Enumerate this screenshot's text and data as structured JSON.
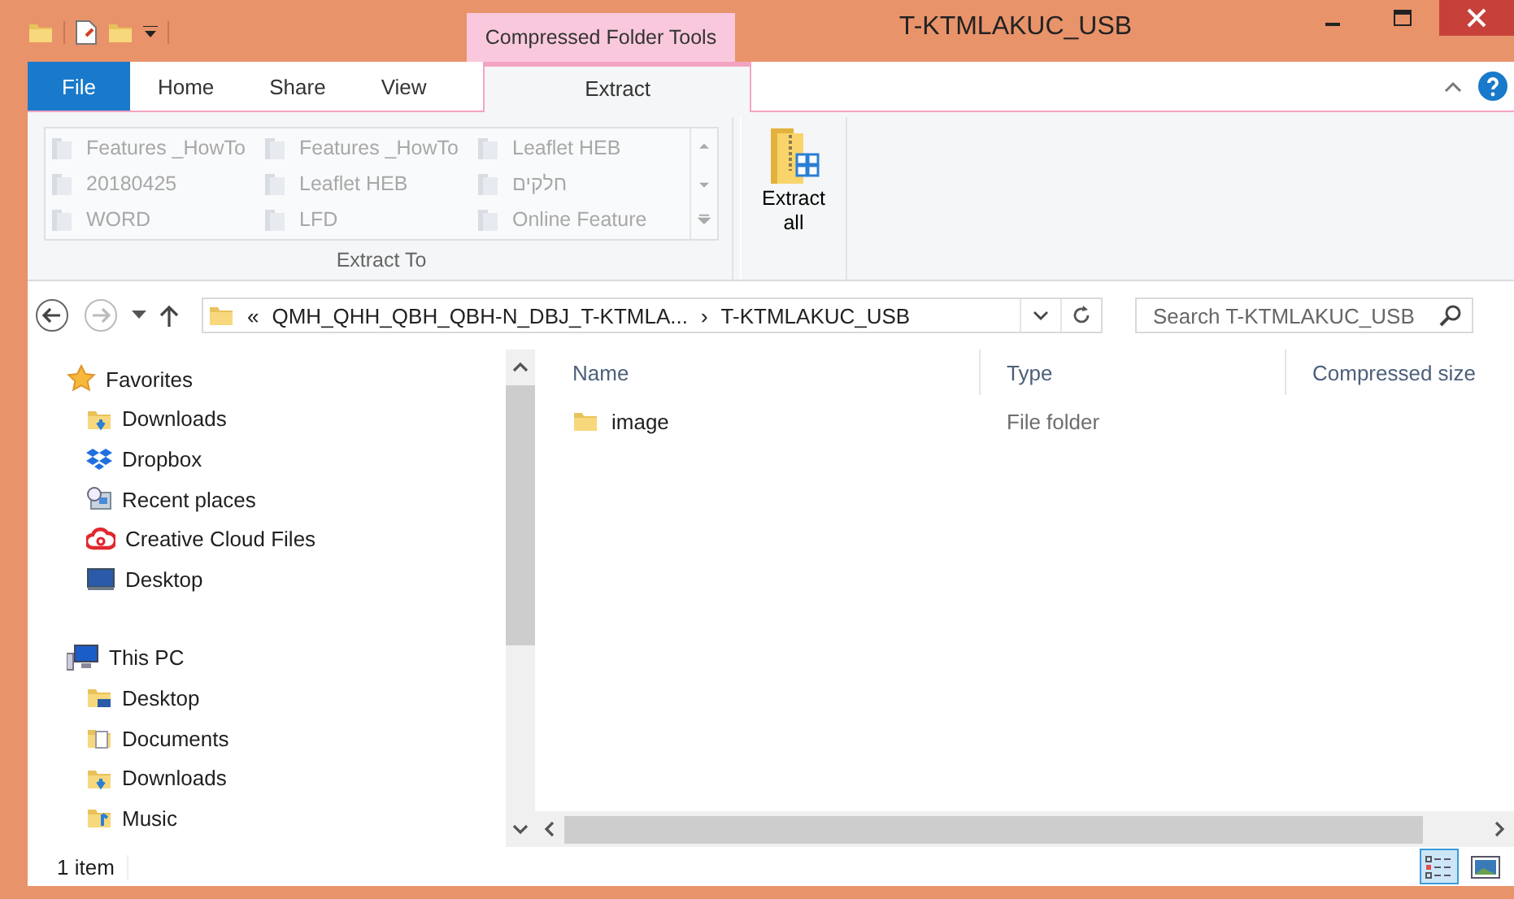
{
  "window": {
    "title": "T-KTMLAKUC_USB",
    "context_tab_group": "Compressed Folder Tools"
  },
  "ribbon_tabs": [
    {
      "label": "File",
      "kind": "file",
      "selected": false
    },
    {
      "label": "Home",
      "kind": "tab",
      "selected": false
    },
    {
      "label": "Share",
      "kind": "tab",
      "selected": false
    },
    {
      "label": "View",
      "kind": "tab",
      "selected": false
    },
    {
      "label": "Extract",
      "kind": "context",
      "selected": true
    }
  ],
  "extract_to": {
    "group_label": "Extract To",
    "items": [
      {
        "label": "Features _HowTo",
        "disabled": true
      },
      {
        "label": "Features _HowTo",
        "disabled": true
      },
      {
        "label": "Leaflet HEB",
        "disabled": true
      },
      {
        "label": "20180425",
        "disabled": true
      },
      {
        "label": "Leaflet HEB",
        "disabled": true
      },
      {
        "label": "חלקים",
        "disabled": true
      },
      {
        "label": "WORD",
        "disabled": true
      },
      {
        "label": "LFD",
        "disabled": true
      },
      {
        "label": "Online Feature",
        "disabled": true
      }
    ]
  },
  "extract_all": {
    "label": "Extract all"
  },
  "address_bar": {
    "overflow": "«",
    "crumbs": [
      "QMH_QHH_QBH_QBH-N_DBJ_T-KTMLA...",
      "T-KTMLAKUC_USB"
    ],
    "separator": "›"
  },
  "search": {
    "placeholder": "Search T-KTMLAKUC_USB"
  },
  "sidebar": {
    "items": [
      {
        "label": "Favorites",
        "kind": "star",
        "children": [
          {
            "label": "Downloads",
            "kind": "downloads"
          },
          {
            "label": "Dropbox",
            "kind": "dropbox"
          },
          {
            "label": "Recent places",
            "kind": "recent"
          },
          {
            "label": "Creative Cloud Files",
            "kind": "cloud"
          },
          {
            "label": "Desktop",
            "kind": "desktop"
          }
        ]
      },
      {
        "label": "This PC",
        "kind": "pc",
        "children": [
          {
            "label": "Desktop",
            "kind": "folder-desktop"
          },
          {
            "label": "Documents",
            "kind": "documents"
          },
          {
            "label": "Downloads",
            "kind": "downloads"
          },
          {
            "label": "Music",
            "kind": "music"
          }
        ]
      }
    ]
  },
  "file_list": {
    "columns": [
      "Name",
      "Type",
      "Compressed size"
    ],
    "rows": [
      {
        "name": "image",
        "type": "File folder"
      }
    ]
  },
  "status_bar": {
    "item_count": "1 item",
    "views": [
      {
        "kind": "details",
        "selected": true
      },
      {
        "kind": "large-icons",
        "selected": false
      }
    ]
  }
}
